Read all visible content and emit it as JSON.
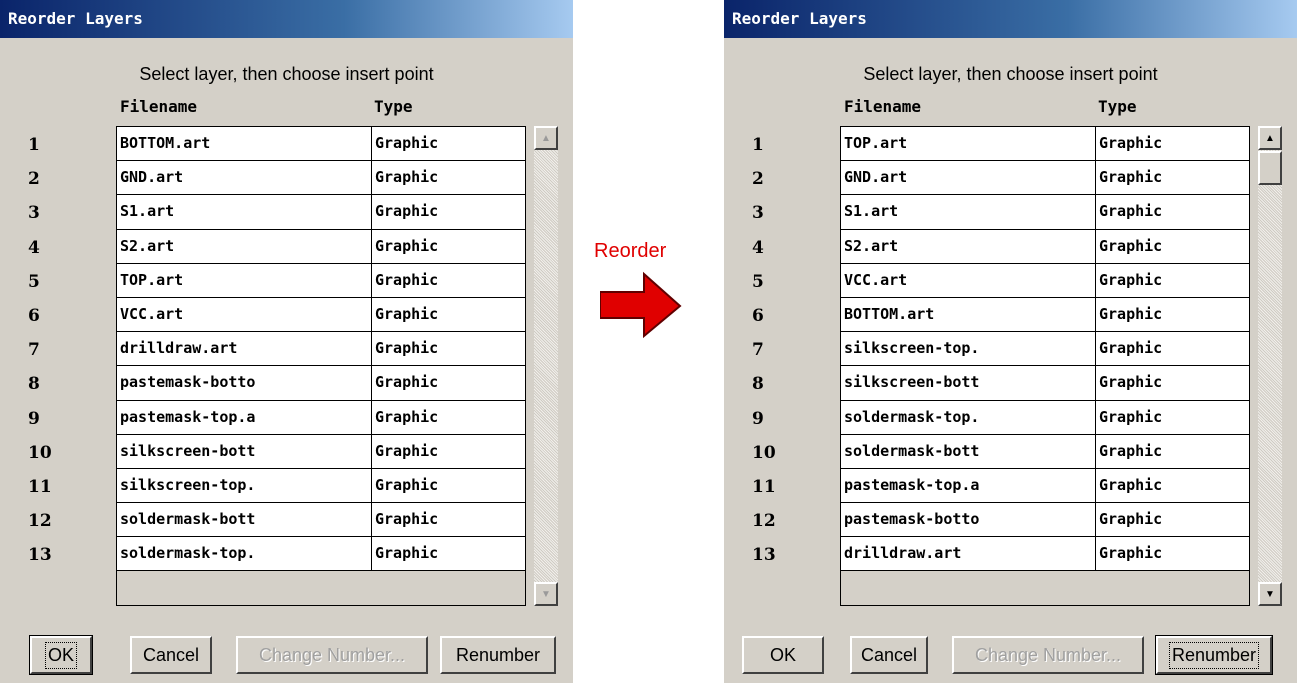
{
  "left_dialog": {
    "title": "Reorder Layers",
    "instruction": "Select layer, then choose insert point",
    "columns": {
      "filename": "Filename",
      "type": "Type"
    },
    "rows": [
      {
        "num": "1",
        "filename": "BOTTOM.art",
        "type": "Graphic"
      },
      {
        "num": "2",
        "filename": "GND.art",
        "type": "Graphic"
      },
      {
        "num": "3",
        "filename": "S1.art",
        "type": "Graphic"
      },
      {
        "num": "4",
        "filename": "S2.art",
        "type": "Graphic"
      },
      {
        "num": "5",
        "filename": "TOP.art",
        "type": "Graphic"
      },
      {
        "num": "6",
        "filename": "VCC.art",
        "type": "Graphic"
      },
      {
        "num": "7",
        "filename": "drilldraw.art",
        "type": "Graphic"
      },
      {
        "num": "8",
        "filename": "pastemask-botto",
        "type": "Graphic"
      },
      {
        "num": "9",
        "filename": "pastemask-top.a",
        "type": "Graphic"
      },
      {
        "num": "10",
        "filename": "silkscreen-bott",
        "type": "Graphic"
      },
      {
        "num": "11",
        "filename": "silkscreen-top.",
        "type": "Graphic"
      },
      {
        "num": "12",
        "filename": "soldermask-bott",
        "type": "Graphic"
      },
      {
        "num": "13",
        "filename": "soldermask-top.",
        "type": "Graphic"
      }
    ],
    "buttons": {
      "ok": "OK",
      "cancel": "Cancel",
      "change_number": "Change Number...",
      "renumber": "Renumber"
    }
  },
  "arrow_label": "Reorder",
  "arrow_color": "#e00000",
  "right_dialog": {
    "title": "Reorder Layers",
    "instruction": "Select layer, then choose insert point",
    "columns": {
      "filename": "Filename",
      "type": "Type"
    },
    "rows": [
      {
        "num": "1",
        "filename": "TOP.art",
        "type": "Graphic"
      },
      {
        "num": "2",
        "filename": "GND.art",
        "type": "Graphic"
      },
      {
        "num": "3",
        "filename": "S1.art",
        "type": "Graphic"
      },
      {
        "num": "4",
        "filename": "S2.art",
        "type": "Graphic"
      },
      {
        "num": "5",
        "filename": "VCC.art",
        "type": "Graphic"
      },
      {
        "num": "6",
        "filename": "BOTTOM.art",
        "type": "Graphic"
      },
      {
        "num": "7",
        "filename": "silkscreen-top.",
        "type": "Graphic"
      },
      {
        "num": "8",
        "filename": "silkscreen-bott",
        "type": "Graphic"
      },
      {
        "num": "9",
        "filename": "soldermask-top.",
        "type": "Graphic"
      },
      {
        "num": "10",
        "filename": "soldermask-bott",
        "type": "Graphic"
      },
      {
        "num": "11",
        "filename": "pastemask-top.a",
        "type": "Graphic"
      },
      {
        "num": "12",
        "filename": "pastemask-botto",
        "type": "Graphic"
      },
      {
        "num": "13",
        "filename": "drilldraw.art",
        "type": "Graphic"
      }
    ],
    "buttons": {
      "ok": "OK",
      "cancel": "Cancel",
      "change_number": "Change Number...",
      "renumber": "Renumber"
    }
  }
}
